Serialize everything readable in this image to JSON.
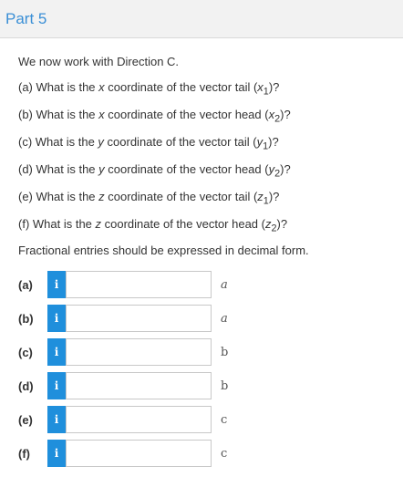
{
  "header": {
    "title": "Part 5"
  },
  "intro": "We now work with Direction C.",
  "questions": [
    {
      "pre": "(a) What is the ",
      "var": "x",
      "mid": " coordinate of the vector tail (",
      "sym": "x",
      "sub": "1",
      "post": ")?"
    },
    {
      "pre": "(b) What is the ",
      "var": "x",
      "mid": " coordinate of the vector head (",
      "sym": "x",
      "sub": "2",
      "post": ")?"
    },
    {
      "pre": "(c) What is the ",
      "var": "y",
      "mid": " coordinate of the vector tail (",
      "sym": "y",
      "sub": "1",
      "post": ")?"
    },
    {
      "pre": "(d) What is the ",
      "var": "y",
      "mid": " coordinate of the vector head (",
      "sym": "y",
      "sub": "2",
      "post": ")?"
    },
    {
      "pre": "(e) What is the ",
      "var": "z",
      "mid": " coordinate of the vector tail (",
      "sym": "z",
      "sub": "1",
      "post": ")?"
    },
    {
      "pre": "(f) What is the ",
      "var": "z",
      "mid": " coordinate of the vector head (",
      "sym": "z",
      "sub": "2",
      "post": ")?"
    }
  ],
  "note": "Fractional entries should be expressed in decimal form.",
  "answers": [
    {
      "label": "(a)",
      "info": "i",
      "value": "",
      "unit": "a"
    },
    {
      "label": "(b)",
      "info": "i",
      "value": "",
      "unit": "a"
    },
    {
      "label": "(c)",
      "info": "i",
      "value": "",
      "unit": "b"
    },
    {
      "label": "(d)",
      "info": "i",
      "value": "",
      "unit": "b"
    },
    {
      "label": "(e)",
      "info": "i",
      "value": "",
      "unit": "c"
    },
    {
      "label": "(f)",
      "info": "i",
      "value": "",
      "unit": "c"
    }
  ]
}
